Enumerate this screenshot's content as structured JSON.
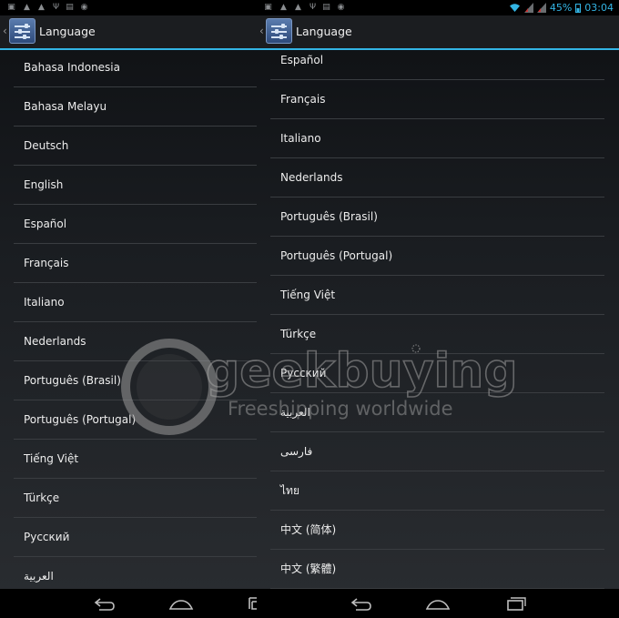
{
  "status_bar": {
    "battery_text": "45%",
    "time": "03:04",
    "accent_color": "#33b5e5"
  },
  "left": {
    "title": "Language",
    "items": [
      "Bahasa Indonesia",
      "Bahasa Melayu",
      "Deutsch",
      "English",
      "Español",
      "Français",
      "Italiano",
      "Nederlands",
      "Português (Brasil)",
      "Português (Portugal)",
      "Tiếng Việt",
      "Türkçe",
      "Русский",
      "العربية"
    ]
  },
  "right": {
    "title": "Language",
    "items": [
      "Español",
      "Français",
      "Italiano",
      "Nederlands",
      "Português (Brasil)",
      "Português (Portugal)",
      "Tiếng Việt",
      "Türkçe",
      "Русский",
      "العربية",
      "فارسی",
      "ไทย",
      "中文 (简体)",
      "中文 (繁體)"
    ]
  },
  "watermark": {
    "brand": "geekbuying",
    "tagline": "Freeshipping worldwide"
  },
  "icons": [
    "back-icon",
    "home-icon",
    "recent-apps-icon",
    "settings-sliders-icon",
    "wifi-icon",
    "signal-icon",
    "battery-icon",
    "warning-icon",
    "usb-icon"
  ]
}
